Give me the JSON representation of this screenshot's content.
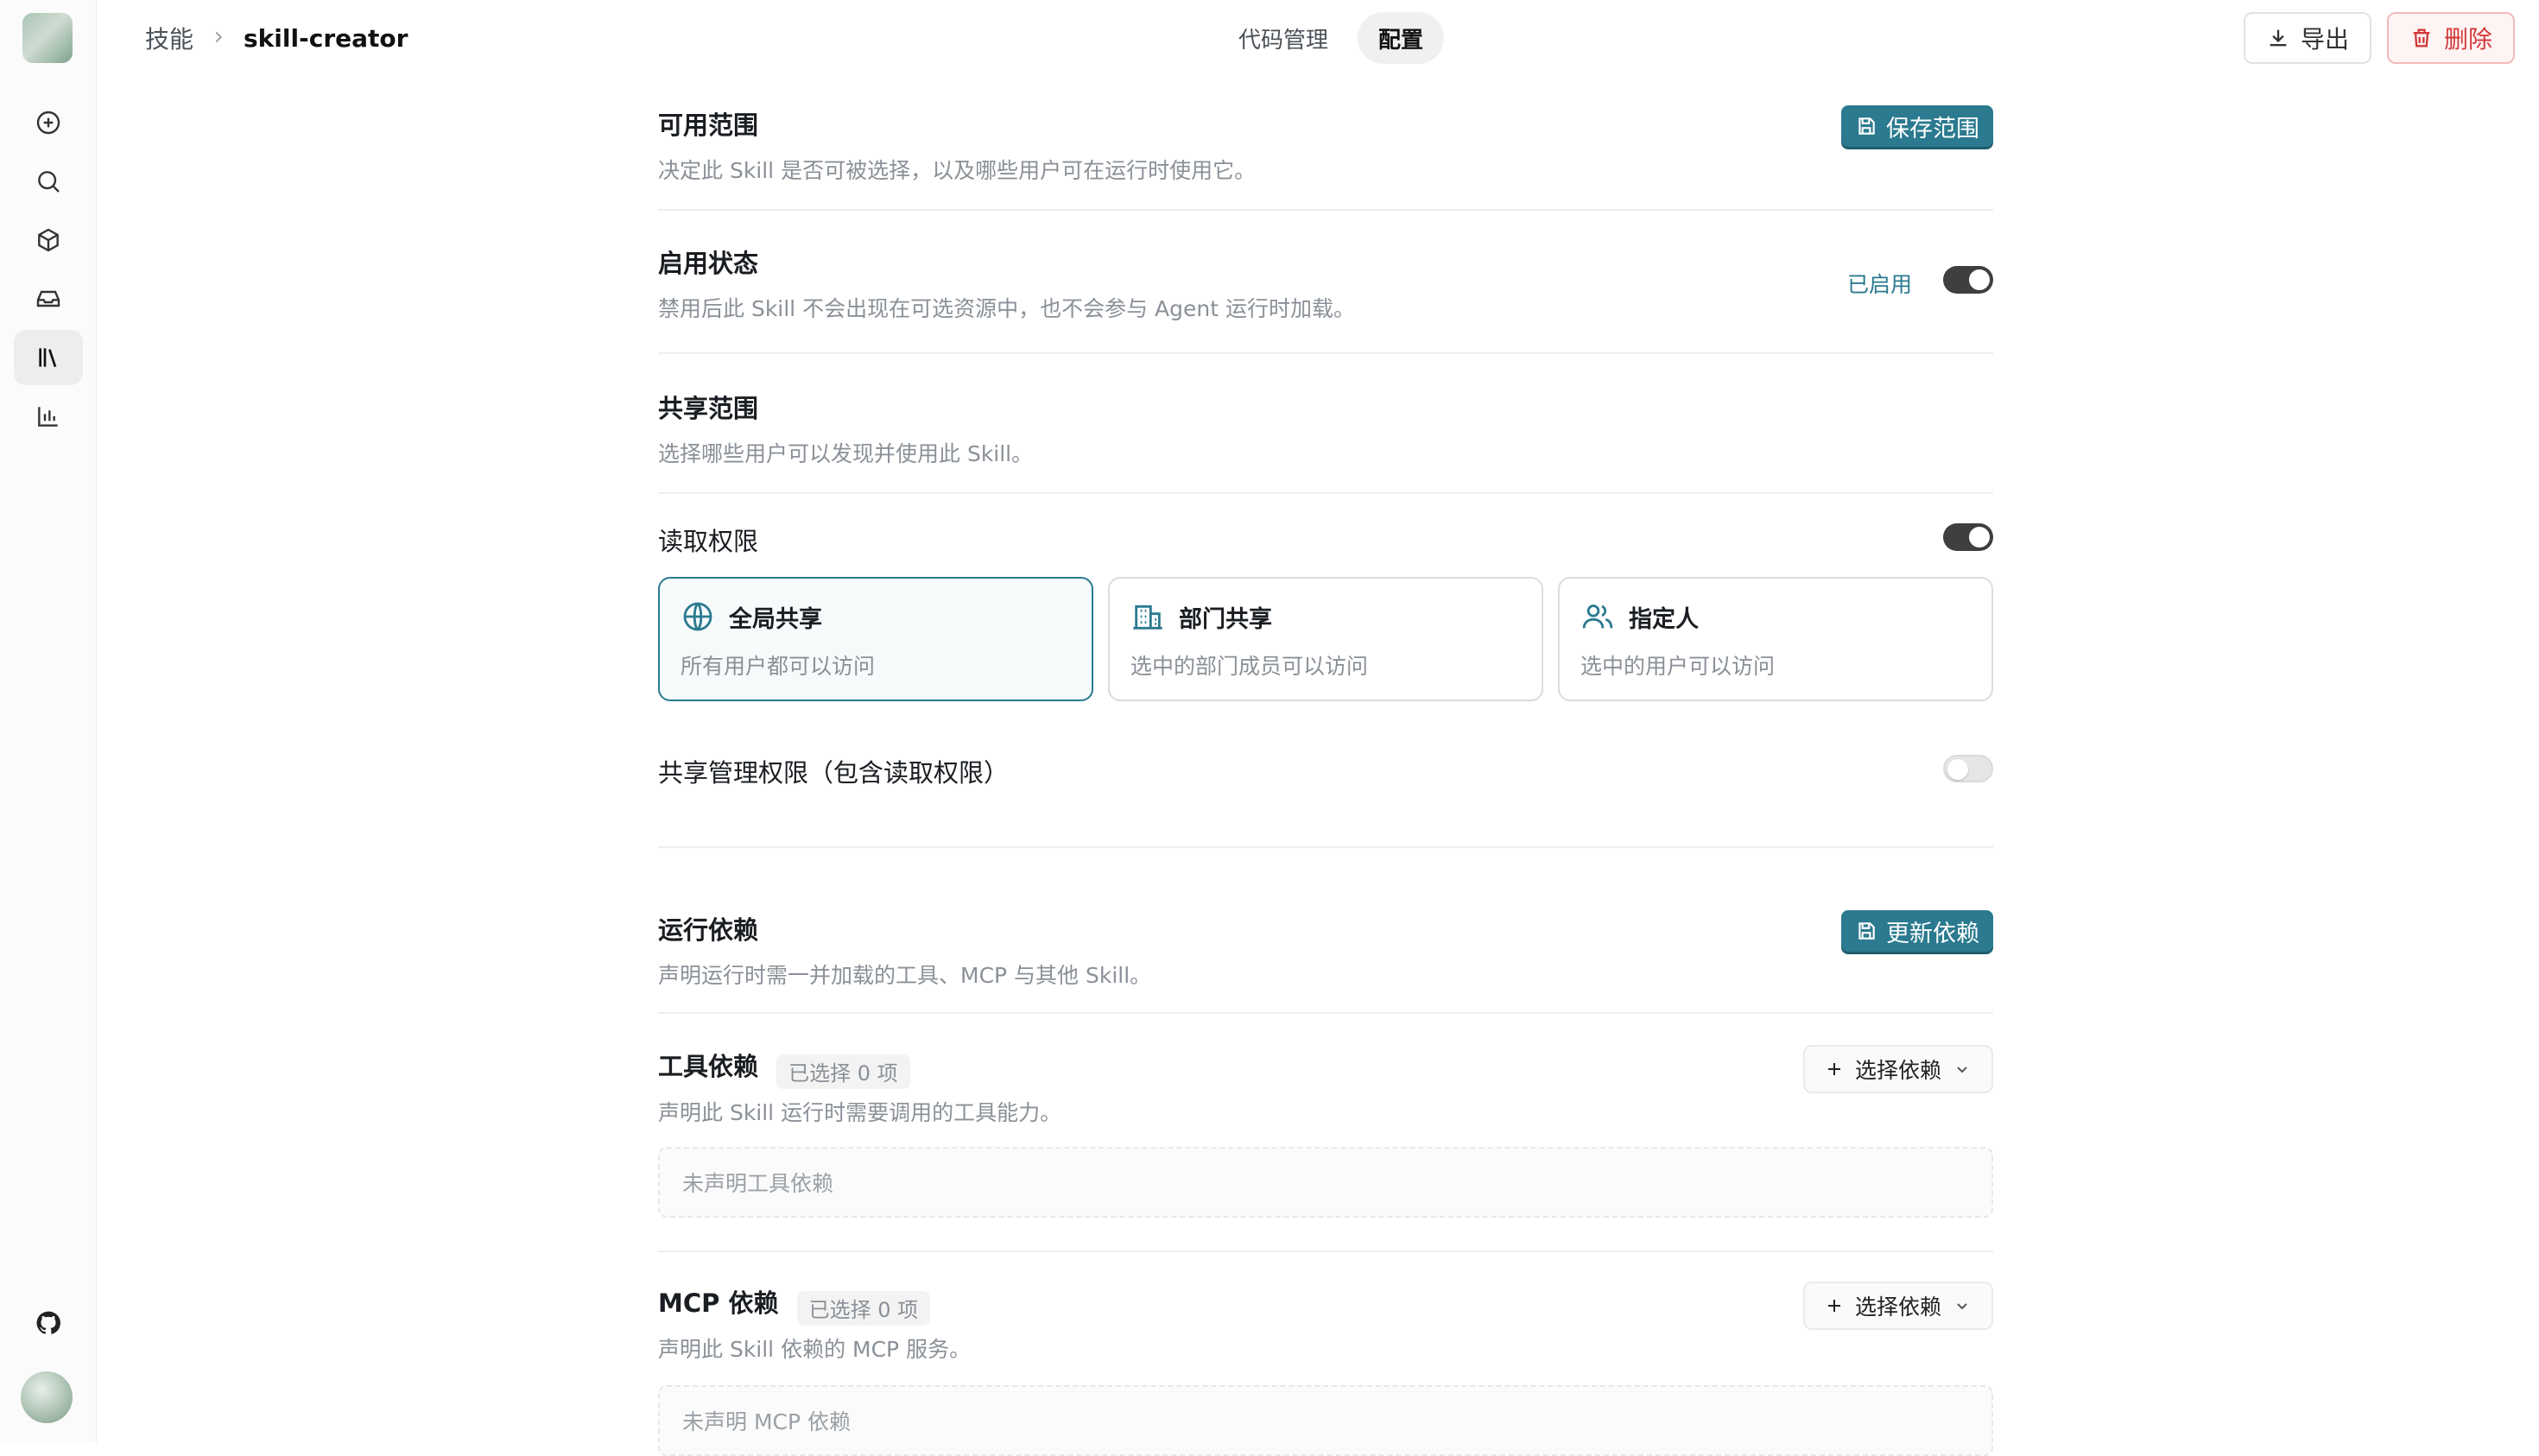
{
  "header": {
    "breadcrumb": {
      "root": "技能",
      "current": "skill-creator"
    },
    "tabs": [
      {
        "label": "代码管理",
        "active": false
      },
      {
        "label": "配置",
        "active": true
      }
    ],
    "actions": {
      "export_label": "导出",
      "delete_label": "删除"
    }
  },
  "sidebar": {
    "icons": [
      "plus-circle-icon",
      "search-icon",
      "cube-icon",
      "inbox-icon",
      "library-icon",
      "chart-icon"
    ],
    "active_index": 4,
    "bottom": [
      "github-icon"
    ]
  },
  "availability": {
    "title": "可用范围",
    "desc": "决定此 Skill 是否可被选择，以及哪些用户可在运行时使用它。",
    "save_label": "保存范围"
  },
  "enable": {
    "title": "启用状态",
    "desc": "禁用后此 Skill 不会出现在可选资源中，也不会参与 Agent 运行时加载。",
    "status": "已启用",
    "on": true
  },
  "share": {
    "title": "共享范围",
    "desc": "选择哪些用户可以发现并使用此 Skill。"
  },
  "read_permission": {
    "title": "读取权限",
    "on": true,
    "options": [
      {
        "title": "全局共享",
        "desc": "所有用户都可以访问",
        "icon": "globe-icon",
        "selected": true
      },
      {
        "title": "部门共享",
        "desc": "选中的部门成员可以访问",
        "icon": "building-icon",
        "selected": false
      },
      {
        "title": "指定人",
        "desc": "选中的用户可以访问",
        "icon": "users-icon",
        "selected": false
      }
    ]
  },
  "manage_permission": {
    "title": "共享管理权限（包含读取权限）",
    "on": false
  },
  "dependencies": {
    "title": "运行依赖",
    "desc": "声明运行时需一并加载的工具、MCP 与其他 Skill。",
    "update_label": "更新依赖",
    "tools": {
      "title": "工具依赖",
      "count": "已选择 0 项",
      "desc": "声明此 Skill 运行时需要调用的工具能力。",
      "select_label": "选择依赖",
      "empty": "未声明工具依赖"
    },
    "mcp": {
      "title": "MCP 依赖",
      "count": "已选择 0 项",
      "desc": "声明此 Skill 依赖的 MCP 服务。",
      "select_label": "选择依赖",
      "empty": "未声明 MCP 依赖"
    }
  },
  "colors": {
    "accent": "#2b7a8f",
    "danger": "#d23a3a",
    "toggle_on": "#3f3f3f"
  }
}
